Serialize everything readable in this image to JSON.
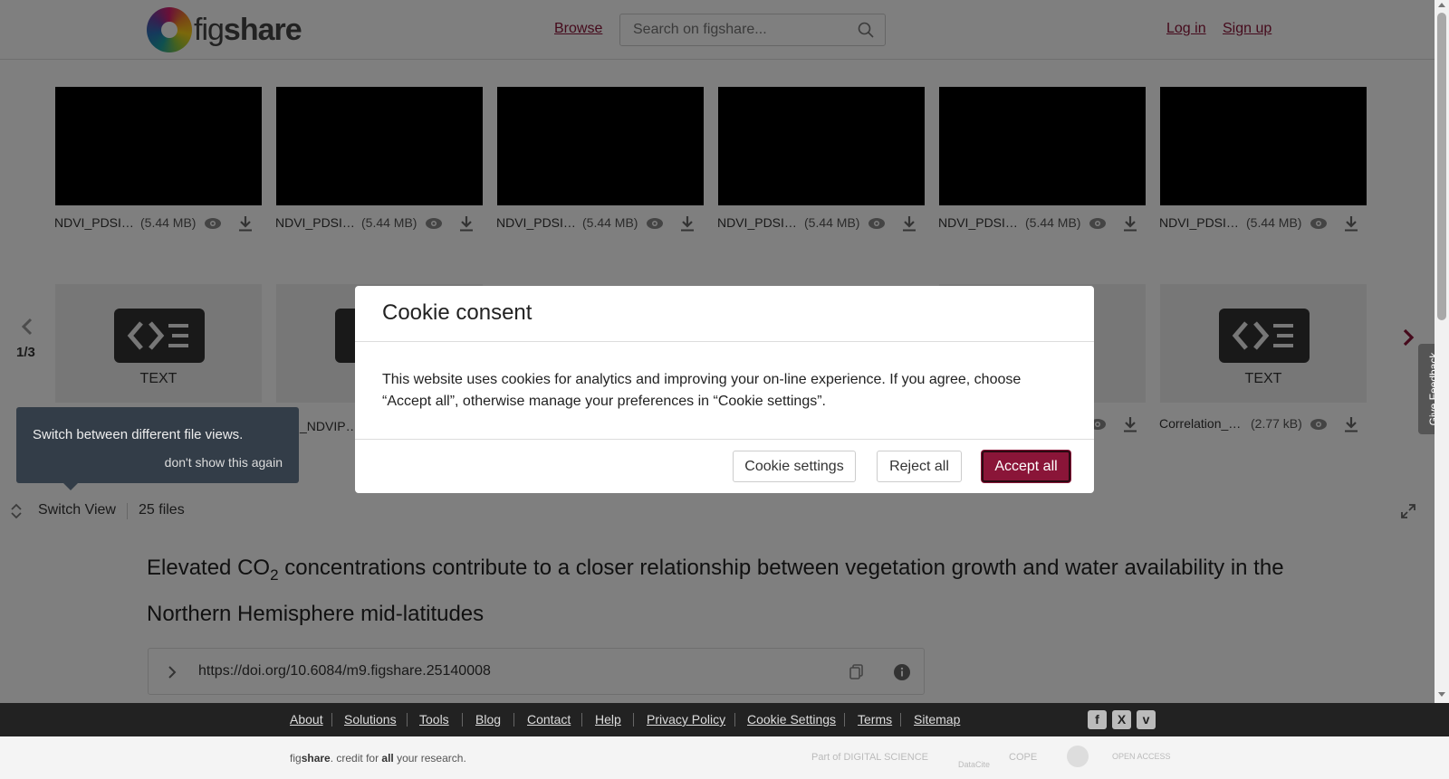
{
  "header": {
    "logo_text_light": "fig",
    "logo_text_bold": "share",
    "browse_label": "Browse",
    "search_placeholder": "Search on figshare...",
    "login_label": "Log in",
    "signup_label": "Sign up"
  },
  "viewer": {
    "top_row": [
      {
        "name": "NDVI_PDSI…",
        "size": "(5.44 MB)"
      },
      {
        "name": "NDVI_PDSI…",
        "size": "(5.44 MB)"
      },
      {
        "name": "NDVI_PDSI…",
        "size": "(5.44 MB)"
      },
      {
        "name": "NDVI_PDSI…",
        "size": "(5.44 MB)"
      },
      {
        "name": "NDVI_PDSI…",
        "size": "(5.44 MB)"
      },
      {
        "name": "NDVI_PDSI…",
        "size": "(5.44 MB)"
      }
    ],
    "bottom_row": [
      {
        "type_label": "TEXT",
        "name": "",
        "size": ""
      },
      {
        "type_label": "",
        "name": "_NDVIP…",
        "size": ""
      },
      {
        "type_label": "TEXT",
        "name": "Correlation_…",
        "size": "(2.77 kB)"
      }
    ],
    "page_indicator": "1/3",
    "tooltip_text": "Switch between different file views.",
    "tooltip_dismiss": "don't show this again",
    "switch_view_label": "Switch View",
    "files_count": "25 files"
  },
  "article": {
    "title_part1": "Elevated CO",
    "title_sub": "2",
    "title_part2": " concentrations contribute to a closer relationship between vegetation growth and water availability in the Northern Hemisphere mid-latitudes",
    "doi": "https://doi.org/10.6084/m9.figshare.25140008"
  },
  "cookie_modal": {
    "title": "Cookie consent",
    "body": "This website uses cookies for analytics and improving your on-line experience. If you agree, choose “Accept all”, otherwise manage your preferences in “Cookie settings”.",
    "settings_label": "Cookie settings",
    "reject_label": "Reject all",
    "accept_label": "Accept all"
  },
  "feedback_label": "Give Feedback",
  "footer": {
    "links": [
      "About",
      "Solutions",
      "Tools",
      "Blog",
      "Contact",
      "Help",
      "Privacy Policy",
      "Cookie Settings",
      "Terms",
      "Sitemap"
    ],
    "social": [
      "facebook-icon",
      "x-icon",
      "vimeo-icon"
    ],
    "tagline_fig": "fig",
    "tagline_share": "share",
    "tagline_mid": ". credit for ",
    "tagline_all": "all",
    "tagline_end": " your research.",
    "partner_ds": "Part of DIGITAL SCIENCE",
    "partner_datacite": "DataCite",
    "partner_cope": "COPE",
    "partner_openaccess": "OPEN ACCESS"
  },
  "colors": {
    "accent": "#8a1538",
    "footer_dark": "#222222",
    "tooltip_bg": "#333d48"
  }
}
